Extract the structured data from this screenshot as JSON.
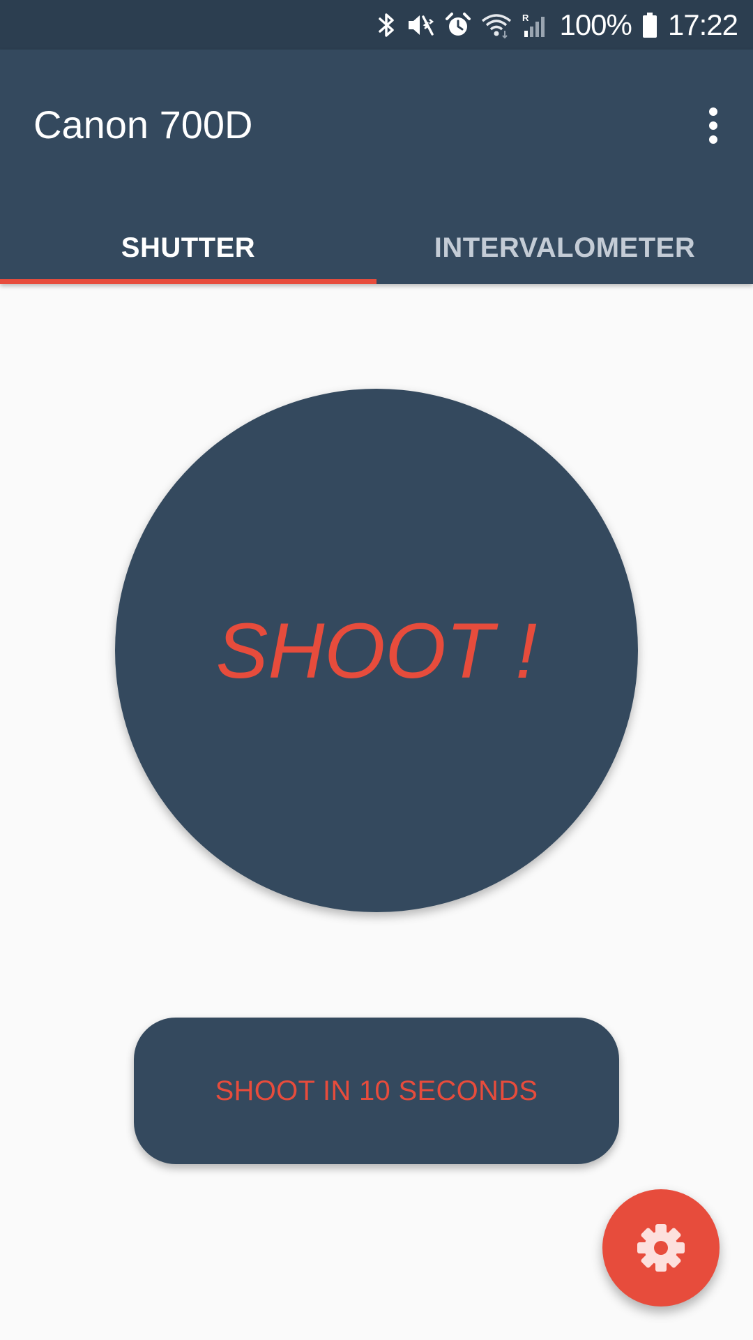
{
  "status_bar": {
    "battery_text": "100%",
    "time": "17:22",
    "icons": [
      "bluetooth-icon",
      "vibrate-mute-icon",
      "alarm-icon",
      "wifi-icon",
      "signal-icon",
      "battery-icon"
    ]
  },
  "app_bar": {
    "title": "Canon 700D",
    "overflow_icon": "more-vert-icon"
  },
  "tabs": [
    {
      "label": "SHUTTER",
      "selected": true
    },
    {
      "label": "INTERVALOMETER",
      "selected": false
    }
  ],
  "main": {
    "shoot_label": "SHOOT !",
    "delay_label": "SHOOT IN 10 SECONDS"
  },
  "fab": {
    "icon": "settings-icon"
  },
  "colors": {
    "primary": "#34495e",
    "primary_dark": "#2c3e50",
    "accent": "#e74c3c",
    "background": "#fafafa"
  }
}
